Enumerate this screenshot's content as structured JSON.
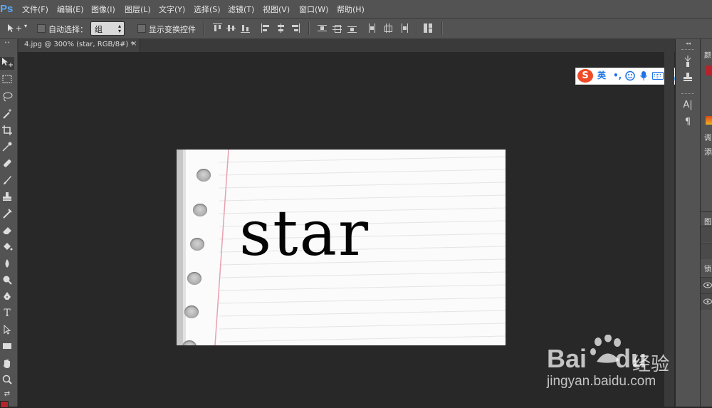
{
  "app": {
    "logo": "Ps"
  },
  "menu": [
    "文件(F)",
    "编辑(E)",
    "图像(I)",
    "图层(L)",
    "文字(Y)",
    "选择(S)",
    "滤镜(T)",
    "视图(V)",
    "窗口(W)",
    "帮助(H)"
  ],
  "options": {
    "auto_select_label": "自动选择：",
    "auto_select_value": "组",
    "show_transform_label": "显示变换控件"
  },
  "document": {
    "tab_label": "4.jpg @ 300% (star, RGB/8#) *",
    "close": "×",
    "canvas_text": "star"
  },
  "ime": {
    "logo": "S",
    "lang": "英",
    "punct": "•,"
  },
  "right_panel": {
    "labels": [
      "颜",
      "调",
      "添",
      "图",
      "锁"
    ]
  },
  "dock": {
    "char_icon": "A|",
    "para_icon": "¶"
  },
  "watermark": {
    "brand": "Bai",
    "brand_tail": "du",
    "cn": "经验",
    "url": "jingyan.baidu.com"
  },
  "colors": {
    "foreground": "#b4242c",
    "accent": "#5aa9f5",
    "ime_blue": "#1c73e8",
    "ime_logo": "#f04b27"
  }
}
